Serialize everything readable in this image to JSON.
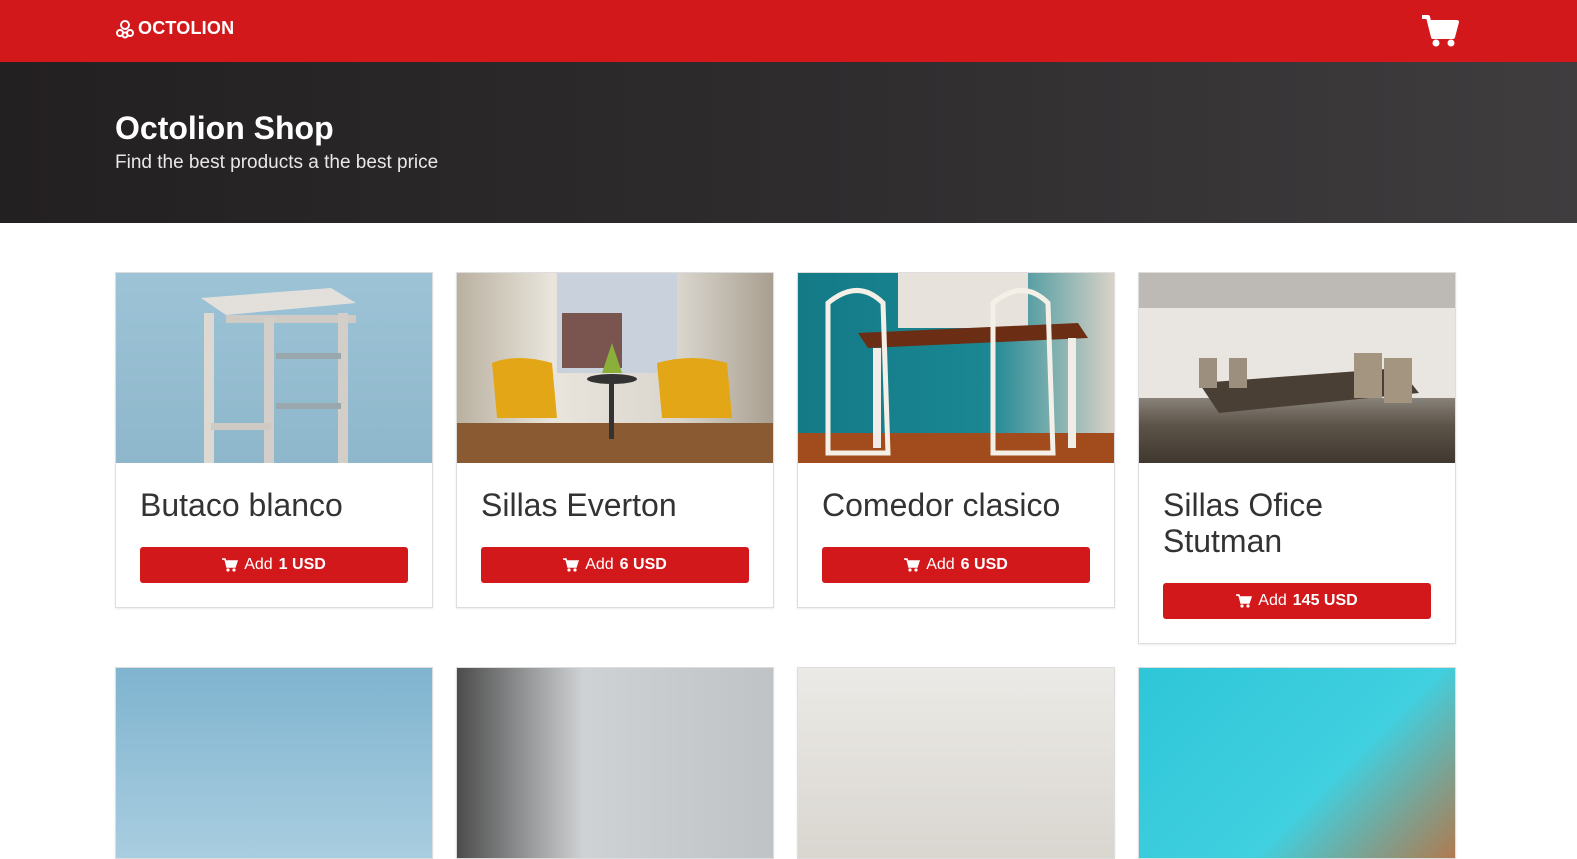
{
  "brand": {
    "name": "OCTOLION",
    "color": "#d3181b"
  },
  "header": {
    "cart_icon": "shopping-cart-icon"
  },
  "hero": {
    "title": "Octolion Shop",
    "subtitle": "Find the best products a the best price"
  },
  "products": [
    {
      "name": "Butaco blanco",
      "add_label": "Add",
      "price": "1 USD",
      "image": "white-stool-image"
    },
    {
      "name": "Sillas Everton",
      "add_label": "Add",
      "price": "6 USD",
      "image": "yellow-armchairs-image"
    },
    {
      "name": "Comedor clasico",
      "add_label": "Add",
      "price": "6 USD",
      "image": "dining-table-image"
    },
    {
      "name": "Sillas Ofice Stutman",
      "add_label": "Add",
      "price": "145 USD",
      "image": "conference-room-image"
    }
  ],
  "products_row2": [
    {
      "image": "sky-image"
    },
    {
      "image": "city-window-image"
    },
    {
      "image": "living-room-image"
    },
    {
      "image": "pool-image"
    }
  ]
}
